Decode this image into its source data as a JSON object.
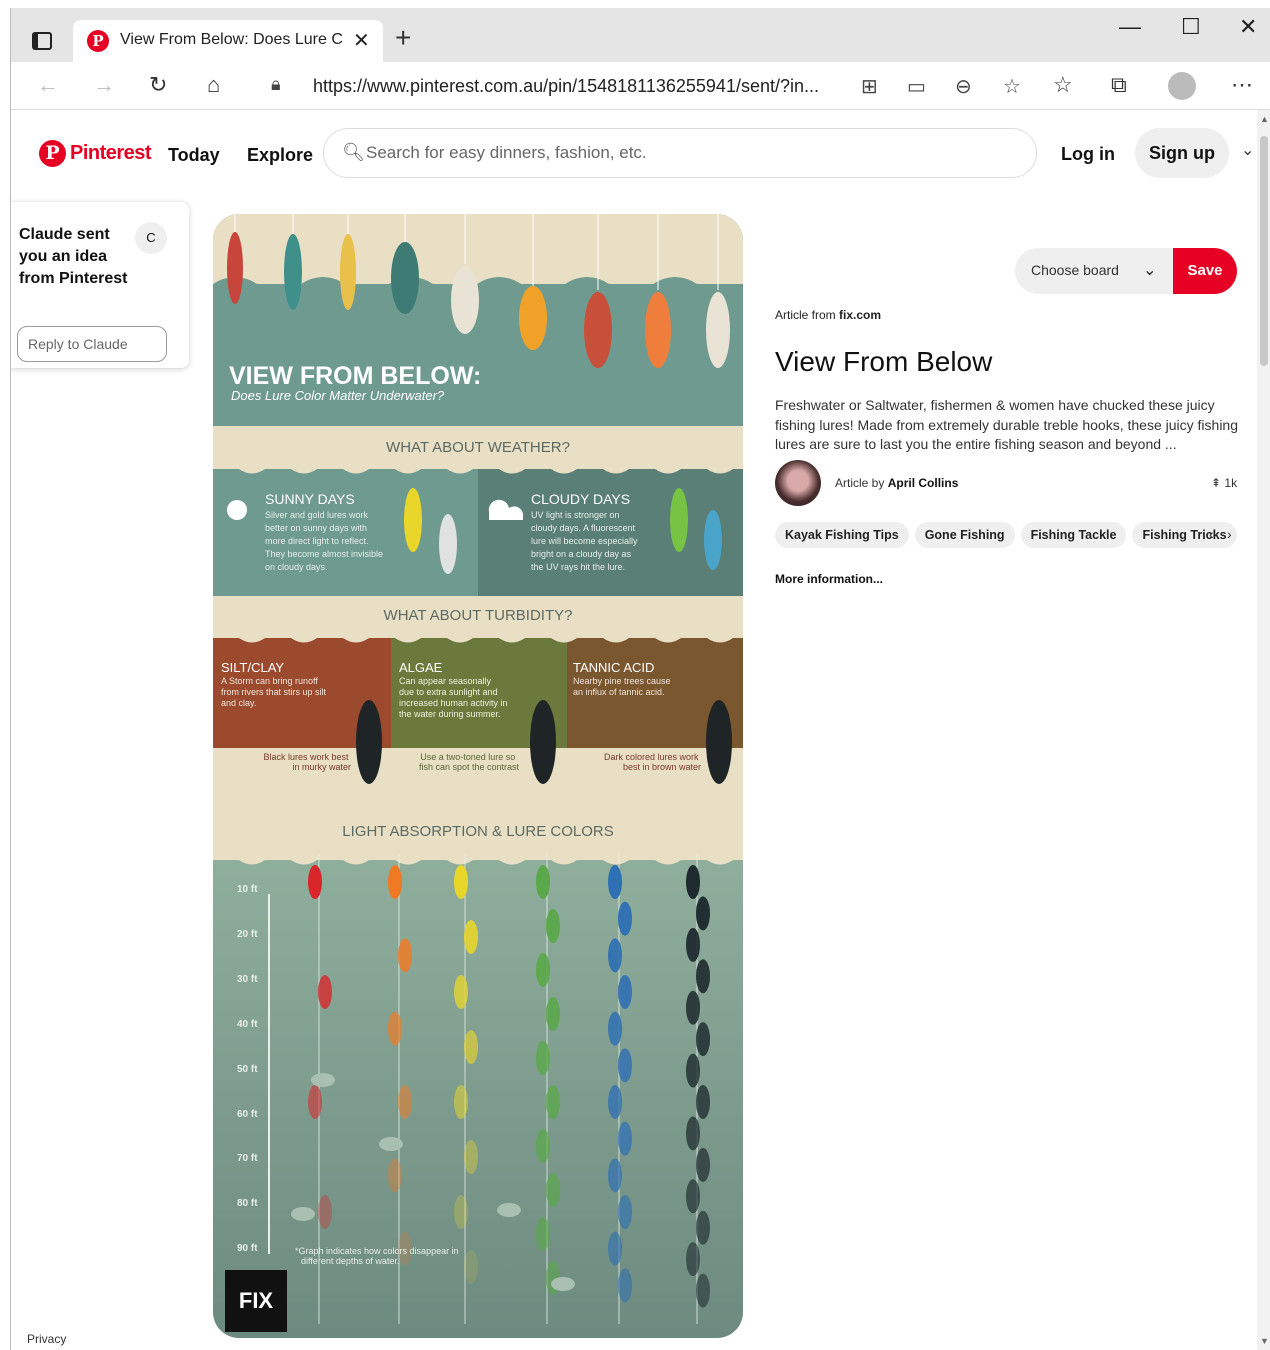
{
  "browser": {
    "tab_title": "View From Below: Does Lure Col",
    "url": "https://www.pinterest.com.au/pin/1548181136255941/sent/?in...",
    "new_tab": "+",
    "tab_close": "✕",
    "minimize": "—",
    "maximize": "☐",
    "close": "✕"
  },
  "header": {
    "logo": "Pinterest",
    "today": "Today",
    "explore": "Explore",
    "search_placeholder": "Search for easy dinners, fashion, etc.",
    "login": "Log in",
    "signup": "Sign up"
  },
  "notice": {
    "message": "Claude sent you an idea from Pinterest",
    "avatar_letter": "C",
    "reply_placeholder": "Reply to Claude"
  },
  "infographic": {
    "title": "VIEW FROM BELOW:",
    "subtitle": "Does Lure Color Matter Underwater?",
    "weather_heading": "WHAT ABOUT WEATHER?",
    "sunny_title": "SUNNY DAYS",
    "sunny_text": [
      "Silver and gold lures work",
      "better on sunny days with",
      "more direct light to reflect.",
      "They become almost invisible",
      "on cloudy days."
    ],
    "cloudy_title": "CLOUDY DAYS",
    "cloudy_text": [
      "UV light is stronger on",
      "cloudy days. A fluorescent",
      "lure will become especially",
      "bright on a cloudy day as",
      "the UV rays hit the lure."
    ],
    "turbidity_heading": "WHAT ABOUT TURBIDITY?",
    "silt_title": "SILT/CLAY",
    "silt_text": [
      "A Storm can bring runoff",
      "from rivers that stirs up silt",
      "and clay."
    ],
    "silt_caption": [
      "Black lures work best",
      "in murky water"
    ],
    "algae_title": "ALGAE",
    "algae_text": [
      "Can appear seasonally",
      "due to extra sunlight and",
      "increased human activity in",
      "the water during summer."
    ],
    "algae_caption": [
      "Use a two-toned lure so",
      "fish can spot the contrast"
    ],
    "tannic_title": "TANNIC ACID",
    "tannic_text": [
      "Nearby pine trees cause",
      "an influx of tannic acid."
    ],
    "tannic_caption": [
      "Dark colored lures work",
      "best in brown water"
    ],
    "light_heading": "LIGHT ABSORPTION & LURE COLORS",
    "depths": [
      "10 ft",
      "20 ft",
      "30 ft",
      "40 ft",
      "50 ft",
      "60 ft",
      "70 ft",
      "80 ft",
      "90 ft"
    ],
    "footnote": [
      "*Graph indicates how colors disappear in",
      "different depths of water."
    ],
    "brand": "FIX",
    "lure_colors": [
      "#d8262a",
      "#f07a24",
      "#e9d62a",
      "#5aa84a",
      "#2f6fb3",
      "#1e2a2e"
    ]
  },
  "pin": {
    "board_select": "Choose board",
    "save": "Save",
    "article_from_prefix": "Article from",
    "article_source": "fix.com",
    "title": "View From Below",
    "description": "Freshwater or Saltwater, fishermen & women have chucked these juicy fishing lures! Made from extremely durable treble hooks, these juicy fishing lures are sure to last you the entire fishing season and beyond ...",
    "author_prefix": "Article by",
    "author": "April Collins",
    "pins_count": "1k",
    "tags": [
      "Kayak Fishing Tips",
      "Gone Fishing",
      "Fishing Tackle",
      "Fishing Tricks"
    ],
    "more_info": "More information..."
  },
  "footer": {
    "privacy": "Privacy"
  }
}
